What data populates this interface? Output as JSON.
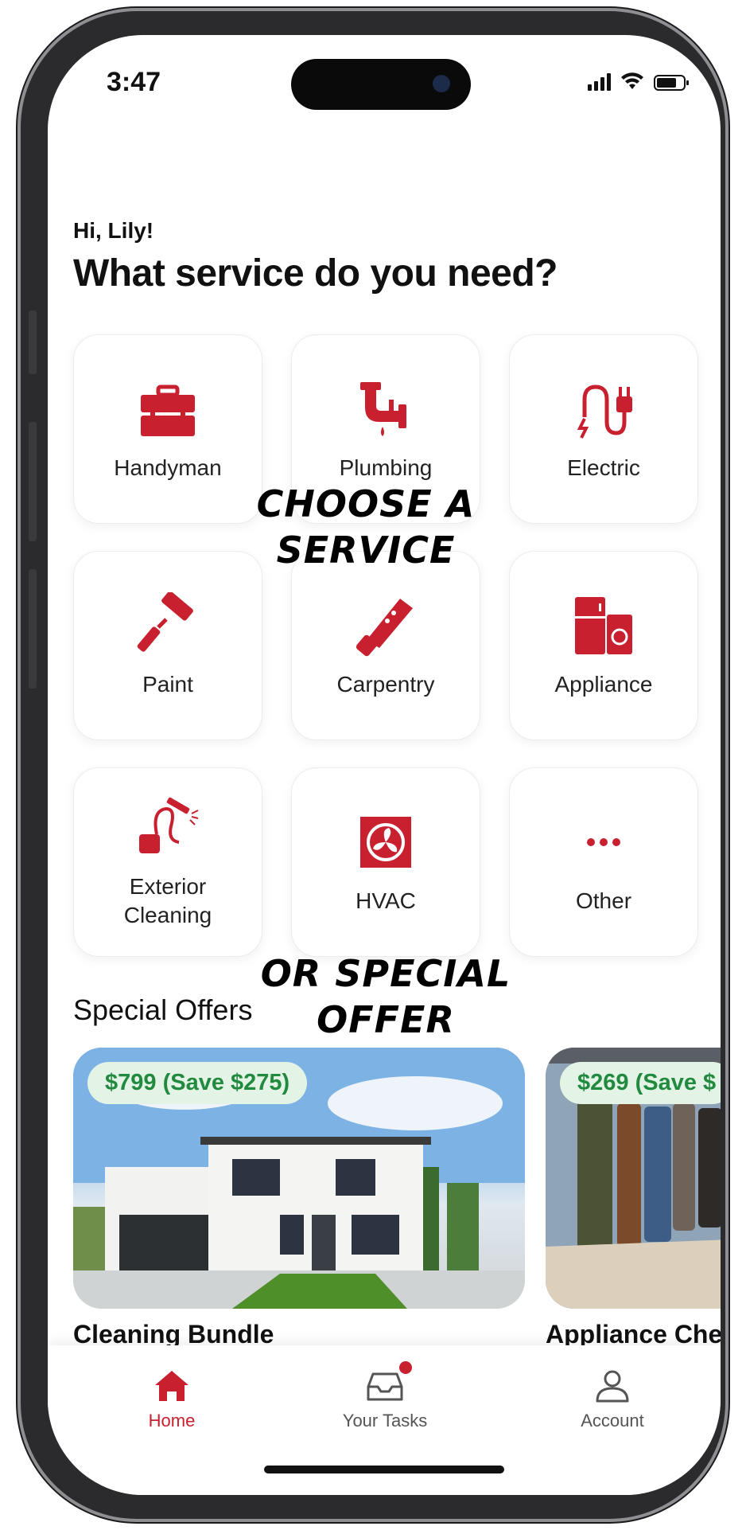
{
  "status_bar": {
    "time": "3:47"
  },
  "greeting": "Hi, Lily!",
  "headline": "What service do you need?",
  "accent_color": "#c8202f",
  "services": [
    {
      "label": "Handyman",
      "icon": "toolbox-icon"
    },
    {
      "label": "Plumbing",
      "icon": "faucet-icon"
    },
    {
      "label": "Electric",
      "icon": "plug-icon"
    },
    {
      "label": "Paint",
      "icon": "paint-roller-icon"
    },
    {
      "label": "Carpentry",
      "icon": "saw-icon"
    },
    {
      "label": "Appliance",
      "icon": "appliance-icon"
    },
    {
      "label": "Exterior\nCleaning",
      "icon": "pressure-washer-icon"
    },
    {
      "label": "HVAC",
      "icon": "fan-icon"
    },
    {
      "label": "Other",
      "icon": "more-dots-icon"
    }
  ],
  "annotations": {
    "choose_service": "CHOOSE A\nSERVICE",
    "special_offer": "OR SPECIAL\nOFFER"
  },
  "offers_title": "Special Offers",
  "offers": [
    {
      "price": "$799 (Save $275)",
      "name": "Cleaning Bundle"
    },
    {
      "price": "$269 (Save $",
      "name": "Appliance Che"
    }
  ],
  "tabs": [
    {
      "label": "Home",
      "icon": "home-icon",
      "active": true
    },
    {
      "label": "Your Tasks",
      "icon": "inbox-icon",
      "active": false,
      "badge": true
    },
    {
      "label": "Account",
      "icon": "user-icon",
      "active": false
    }
  ]
}
